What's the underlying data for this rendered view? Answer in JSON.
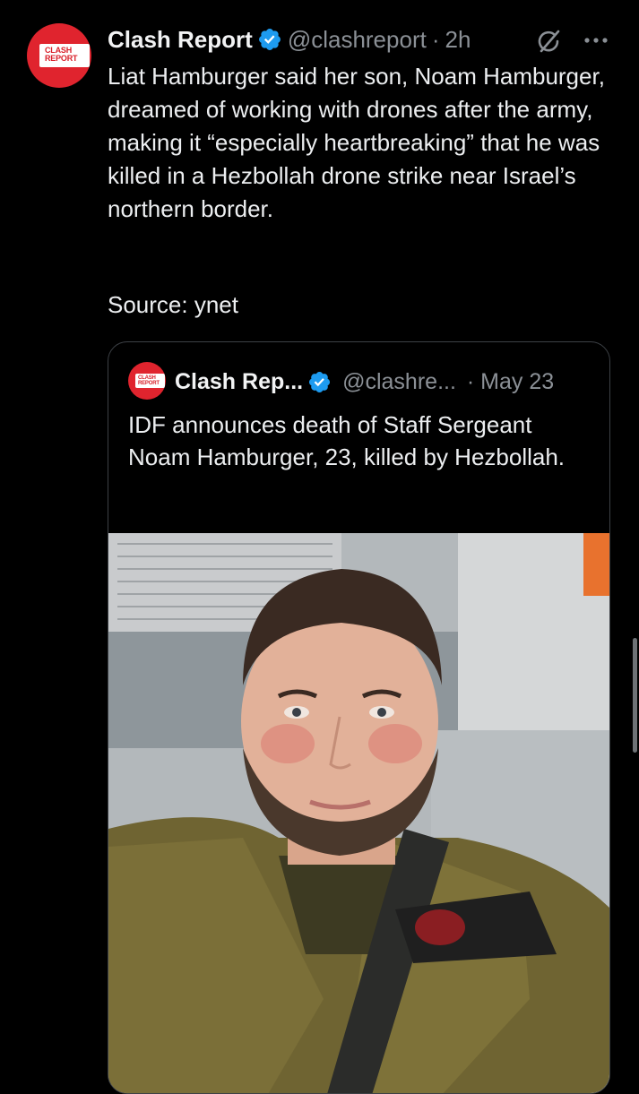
{
  "tweet": {
    "avatar_logo": [
      "CLASH",
      "REPORT"
    ],
    "author_name": "Clash Report",
    "handle": "@clashreport",
    "separator": "·",
    "time": "2h",
    "body": "Liat Hamburger said her son, Noam Hamburger, dreamed of working with drones after the army, making it “especially heartbreaking” that he was killed in a Hezbollah drone strike near Israel’s northern border.",
    "source": "Source: ynet",
    "icons": {
      "verified": "verified-badge-icon",
      "grok": "grok-icon",
      "more": "more-options-icon"
    },
    "accent_color": "#1d9bf0"
  },
  "quoted_tweet": {
    "avatar_logo": [
      "CLASH",
      "REPORT"
    ],
    "author_name": "Clash Rep...",
    "handle": "@clashre...",
    "date": "· May 23",
    "body": "IDF announces death of Staff Sergeant Noam Hamburger, 23, killed by Hezbollah.",
    "media_description": "portrait photo"
  }
}
